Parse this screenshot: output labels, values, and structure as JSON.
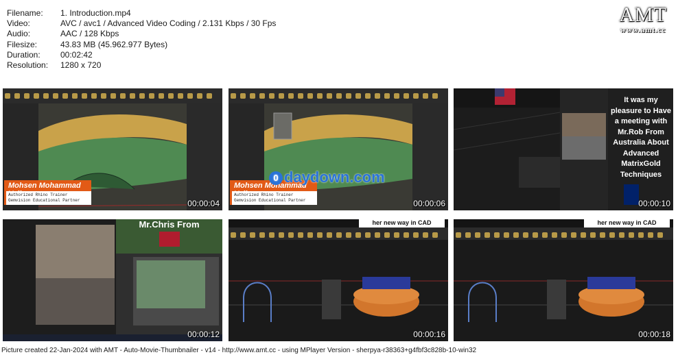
{
  "info": {
    "labels": [
      "Filename:",
      "Video:",
      "Audio:",
      "Filesize:",
      "Duration:",
      "Resolution:"
    ],
    "filename": "1. Introduction.mp4",
    "video": "AVC / avc1 / Advanced Video Coding / 2.131 Kbps / 30 Fps",
    "audio": "AAC / 128 Kbps",
    "filesize": "43.83 MB (45.962.977 Bytes)",
    "duration": "00:02:42",
    "resolution": "1280 x 720"
  },
  "logo": {
    "title": "AMT",
    "url": "www.amt.cc"
  },
  "thumbs": [
    {
      "time": "00:00:04",
      "name": "Mohsen Mohammad Vali",
      "sub1": "Authorized Rhino Trainer",
      "sub2": "Gemvision Educational Partner"
    },
    {
      "time": "00:00:06",
      "name": "Mohsen Mohammad Vali",
      "sub1": "Authorized Rhino Trainer",
      "sub2": "Gemvision Educational Partner"
    },
    {
      "time": "00:00:10",
      "caption": "It was my pleasure to Have a meeting with Mr.Rob From Australia About Advanced MatrixGold Techniques"
    },
    {
      "time": "00:00:12",
      "caption": "Mr.Chris From"
    },
    {
      "time": "00:00:16",
      "caption": "her new way in CAD"
    },
    {
      "time": "00:00:18",
      "caption": "her new way in CAD"
    }
  ],
  "watermark": "daydown.com",
  "footer": "Picture created 22-Jan-2024 with AMT - Auto-Movie-Thumbnailer - v14 - http://www.amt.cc - using MPlayer Version - sherpya-r38363+g4fbf3c828b-10-win32",
  "colors": {
    "accent_orange": "#e25a16",
    "rhino_gold": "#c9a24a",
    "rhino_green": "#4f8a52"
  }
}
